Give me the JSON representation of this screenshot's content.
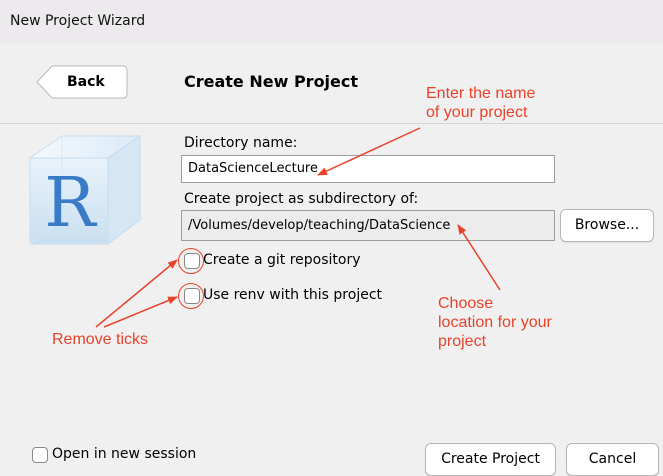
{
  "window": {
    "title": "New Project Wizard"
  },
  "header": {
    "back_label": "Back",
    "heading": "Create New Project"
  },
  "form": {
    "directory_label": "Directory name:",
    "directory_value": "DataScienceLecture",
    "parent_label": "Create project as subdirectory of:",
    "parent_value": "/Volumes/develop/teaching/DataScience",
    "browse_label": "Browse...",
    "git_label": "Create a git repository",
    "git_checked": false,
    "renv_label": "Use renv with this project",
    "renv_checked": false
  },
  "footer": {
    "new_session_label": "Open in new session",
    "new_session_checked": false,
    "create_label": "Create Project",
    "cancel_label": "Cancel"
  },
  "annotations": {
    "name_hint": [
      "Enter the name",
      "of your project"
    ],
    "location_hint": [
      "Choose",
      "location for your",
      "project"
    ],
    "ticks_hint": "Remove ticks",
    "color": "#e8432a"
  },
  "icons": {
    "logo": "r-cube-icon"
  }
}
